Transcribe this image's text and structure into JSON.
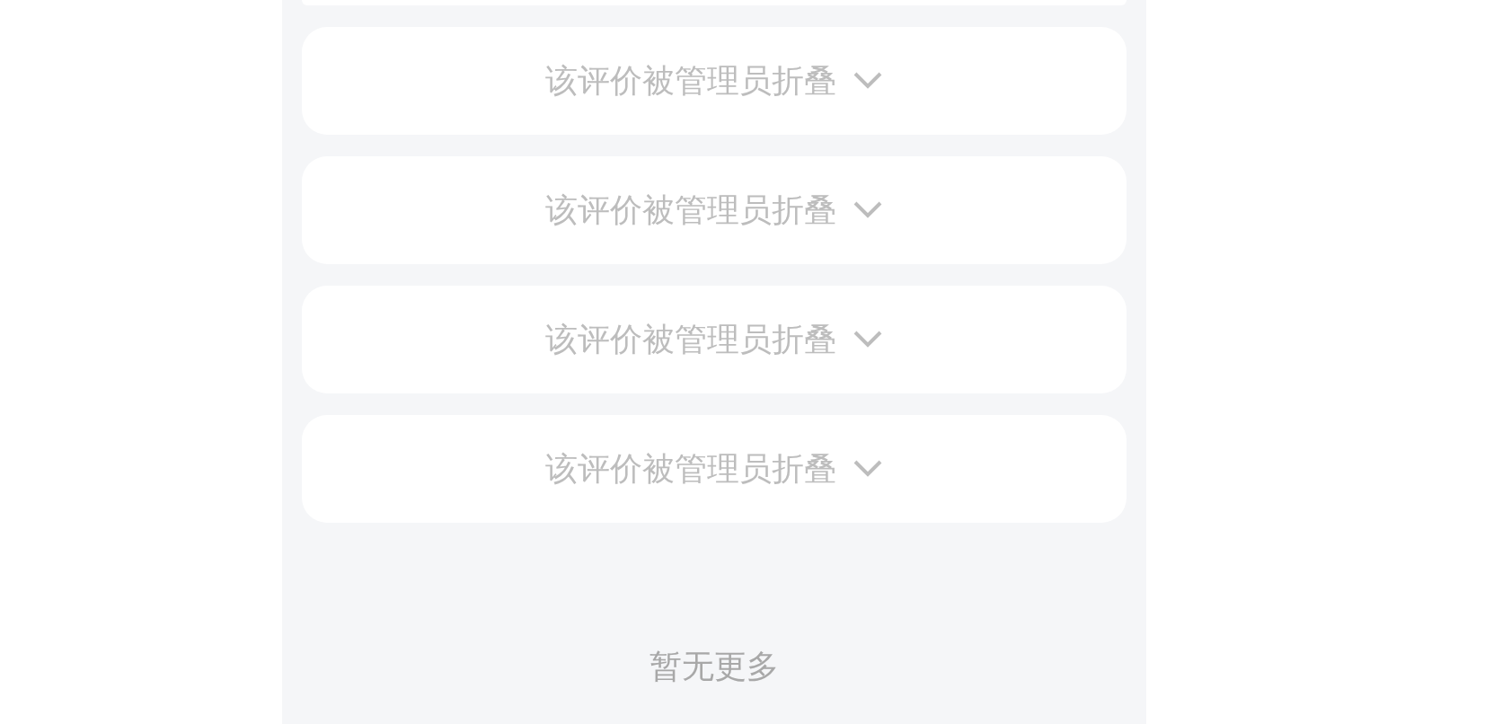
{
  "collapsed_reviews": [
    {
      "text": "该评价被管理员折叠"
    },
    {
      "text": "该评价被管理员折叠"
    },
    {
      "text": "该评价被管理员折叠"
    },
    {
      "text": "该评价被管理员折叠"
    }
  ],
  "footer": "暂无更多"
}
